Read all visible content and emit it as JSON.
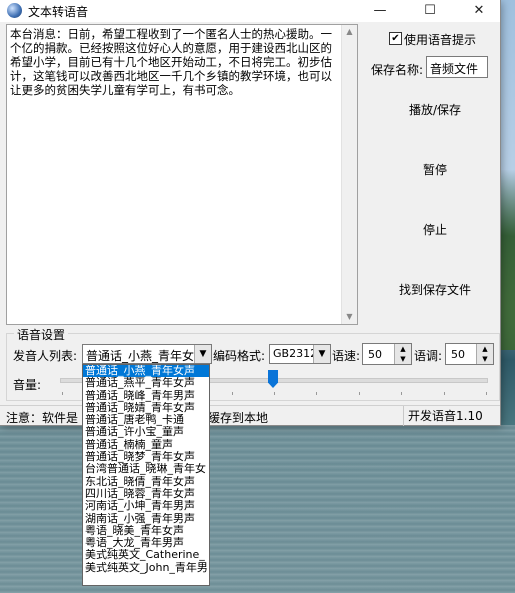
{
  "window": {
    "title": "文本转语音",
    "minimize": "—",
    "maximize": "☐",
    "close": "✕"
  },
  "text_content": "本台消息：日前，希望工程收到了一个匿名人士的热心援助。一个亿的捐款。已经按照这位好心人的意愿，用于建设西北山区的希望小学，目前已有十几个地区开始动工，不日将完工。初步估计，这笔钱可以改善西北地区一千几个乡镇的教学环境，也可以让更多的贫困失学儿童有学可上，有书可念。",
  "options": {
    "use_voice_prompt_label": "使用语音提示",
    "use_voice_prompt_checked": true,
    "check_mark": "✔",
    "save_name_label": "保存名称:",
    "save_name_value": "音频文件"
  },
  "buttons": {
    "play_save": "播放/保存",
    "pause": "暂停",
    "stop": "停止",
    "find_saved": "找到保存文件"
  },
  "voice_settings": {
    "group_title": "语音设置",
    "speaker_label": "发音人列表:",
    "speaker_value": "普通话_小燕_青年女",
    "encoding_label": "编码格式:",
    "encoding_value": "GB2312",
    "speed_label": "语速:",
    "speed_value": "50",
    "pitch_label": "语调:",
    "pitch_value": "50",
    "volume_label": "音量:",
    "volume_level_fraction": 0.5
  },
  "speaker_list": [
    "普通话_小燕_青年女声",
    "普通话_燕平_青年女声",
    "普通话_晓峰_青年男声",
    "普通话_晓婧_青年女声",
    "普通话_唐老鸭_卡通",
    "普通话_许小宝_童声",
    "普通话_楠楠_童声",
    "普通话_晓梦_青年女声",
    "台湾普通话_晓琳_青年女",
    "东北话_晓倩_青年女声",
    "四川话_晓蓉_青年女声",
    "河南话_小坤_青年男声",
    "湖南话_小强_青年男声",
    "粤语_晓美_青年女声",
    "粤语_大龙_青年男声",
    "美式纯英文_Catherine_",
    "美式纯英文_John_青年男"
  ],
  "status": {
    "note": "注意：软件是",
    "note_tail": "频缓存到本地",
    "version": "开发语音1.10"
  },
  "icons": {
    "app": "app-globe-icon",
    "dropdown": "chevron-down-icon"
  }
}
